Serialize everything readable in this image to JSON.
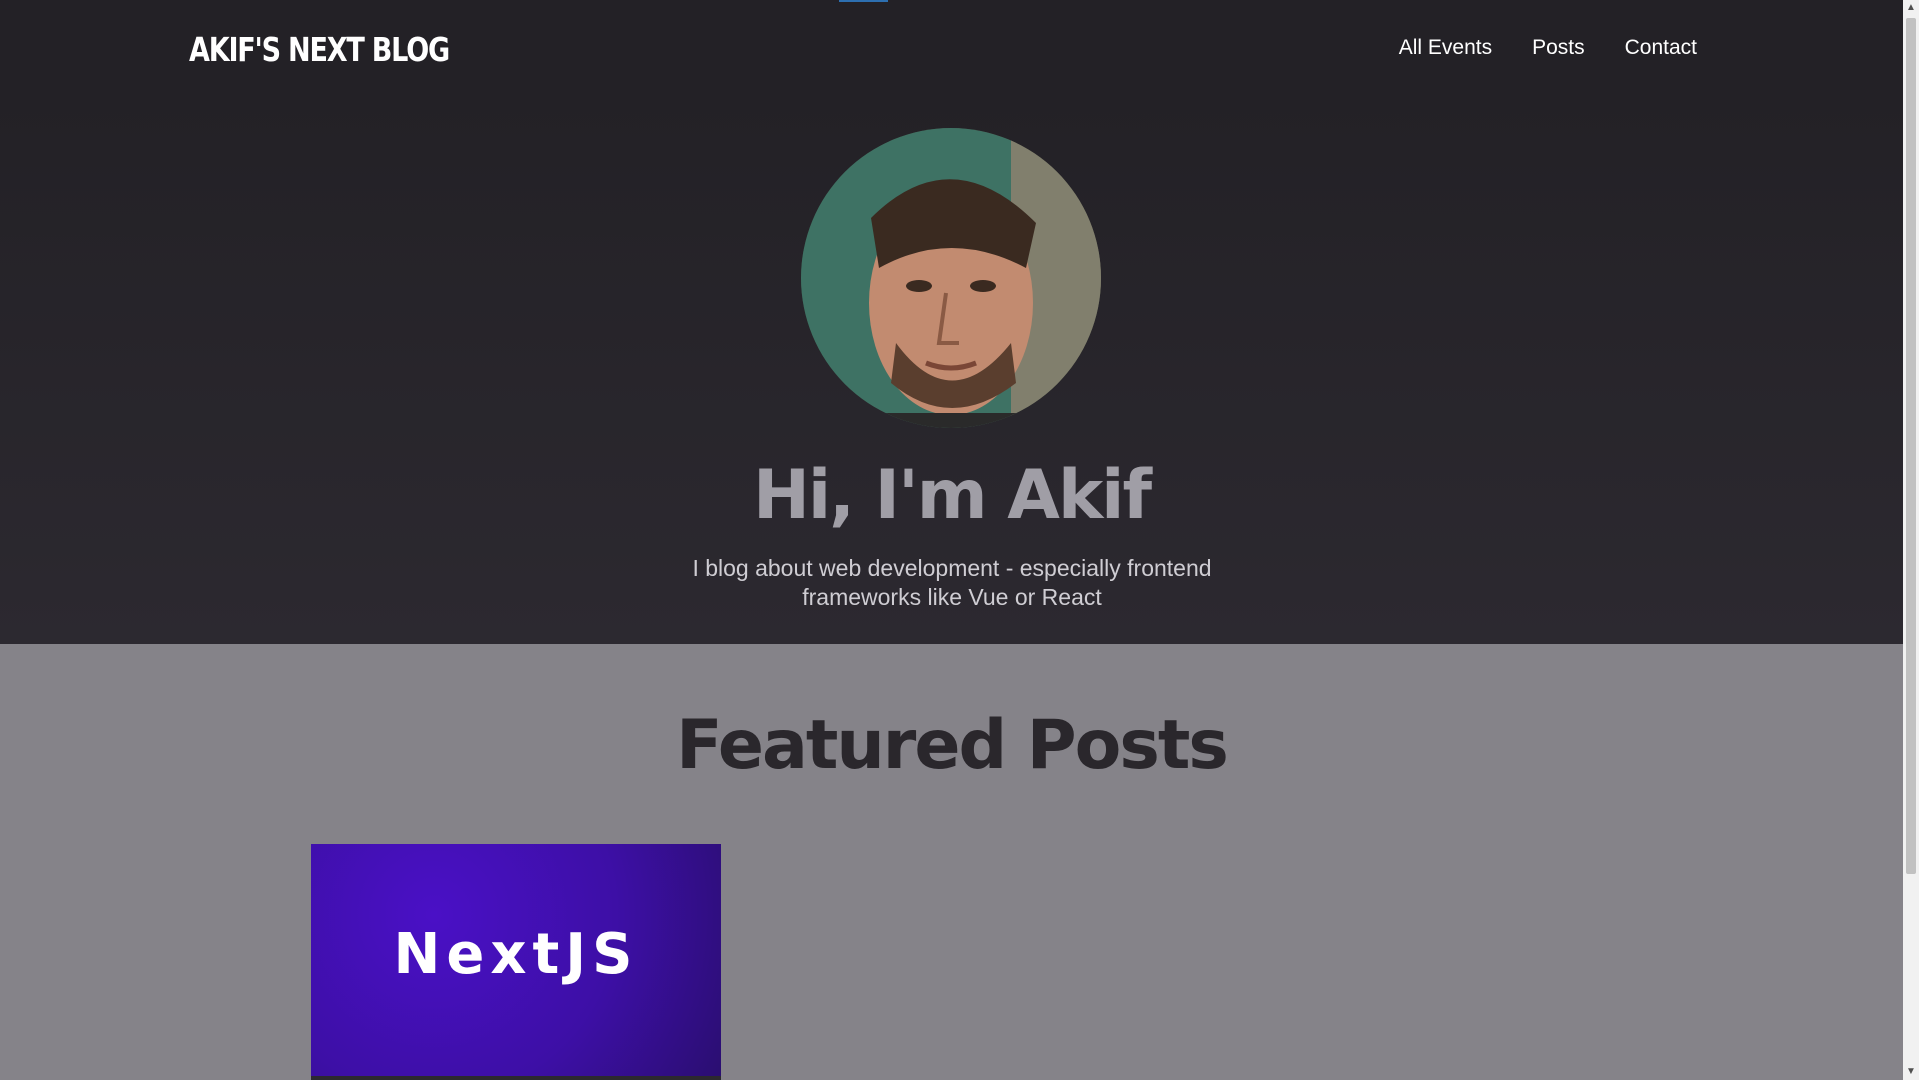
{
  "header": {
    "logo": "AKIF'S NEXT BLOG",
    "nav": [
      "All Events",
      "Posts",
      "Contact"
    ]
  },
  "hero": {
    "title": "Hi, I'm Akif",
    "text": "I blog about web development - especially frontend frameworks like Vue or React"
  },
  "featured": {
    "title": "Featured Posts",
    "posts": [
      {
        "thumbnail_text": "NextJS"
      }
    ]
  },
  "colors": {
    "header_bg": "#232126",
    "page_bg": "#858389",
    "accent": "#2d6fb0",
    "card_bg": "#4a10c6"
  },
  "scrollbar": {
    "up_icon": "chevron-up-icon",
    "down_icon": "chevron-down-icon"
  }
}
